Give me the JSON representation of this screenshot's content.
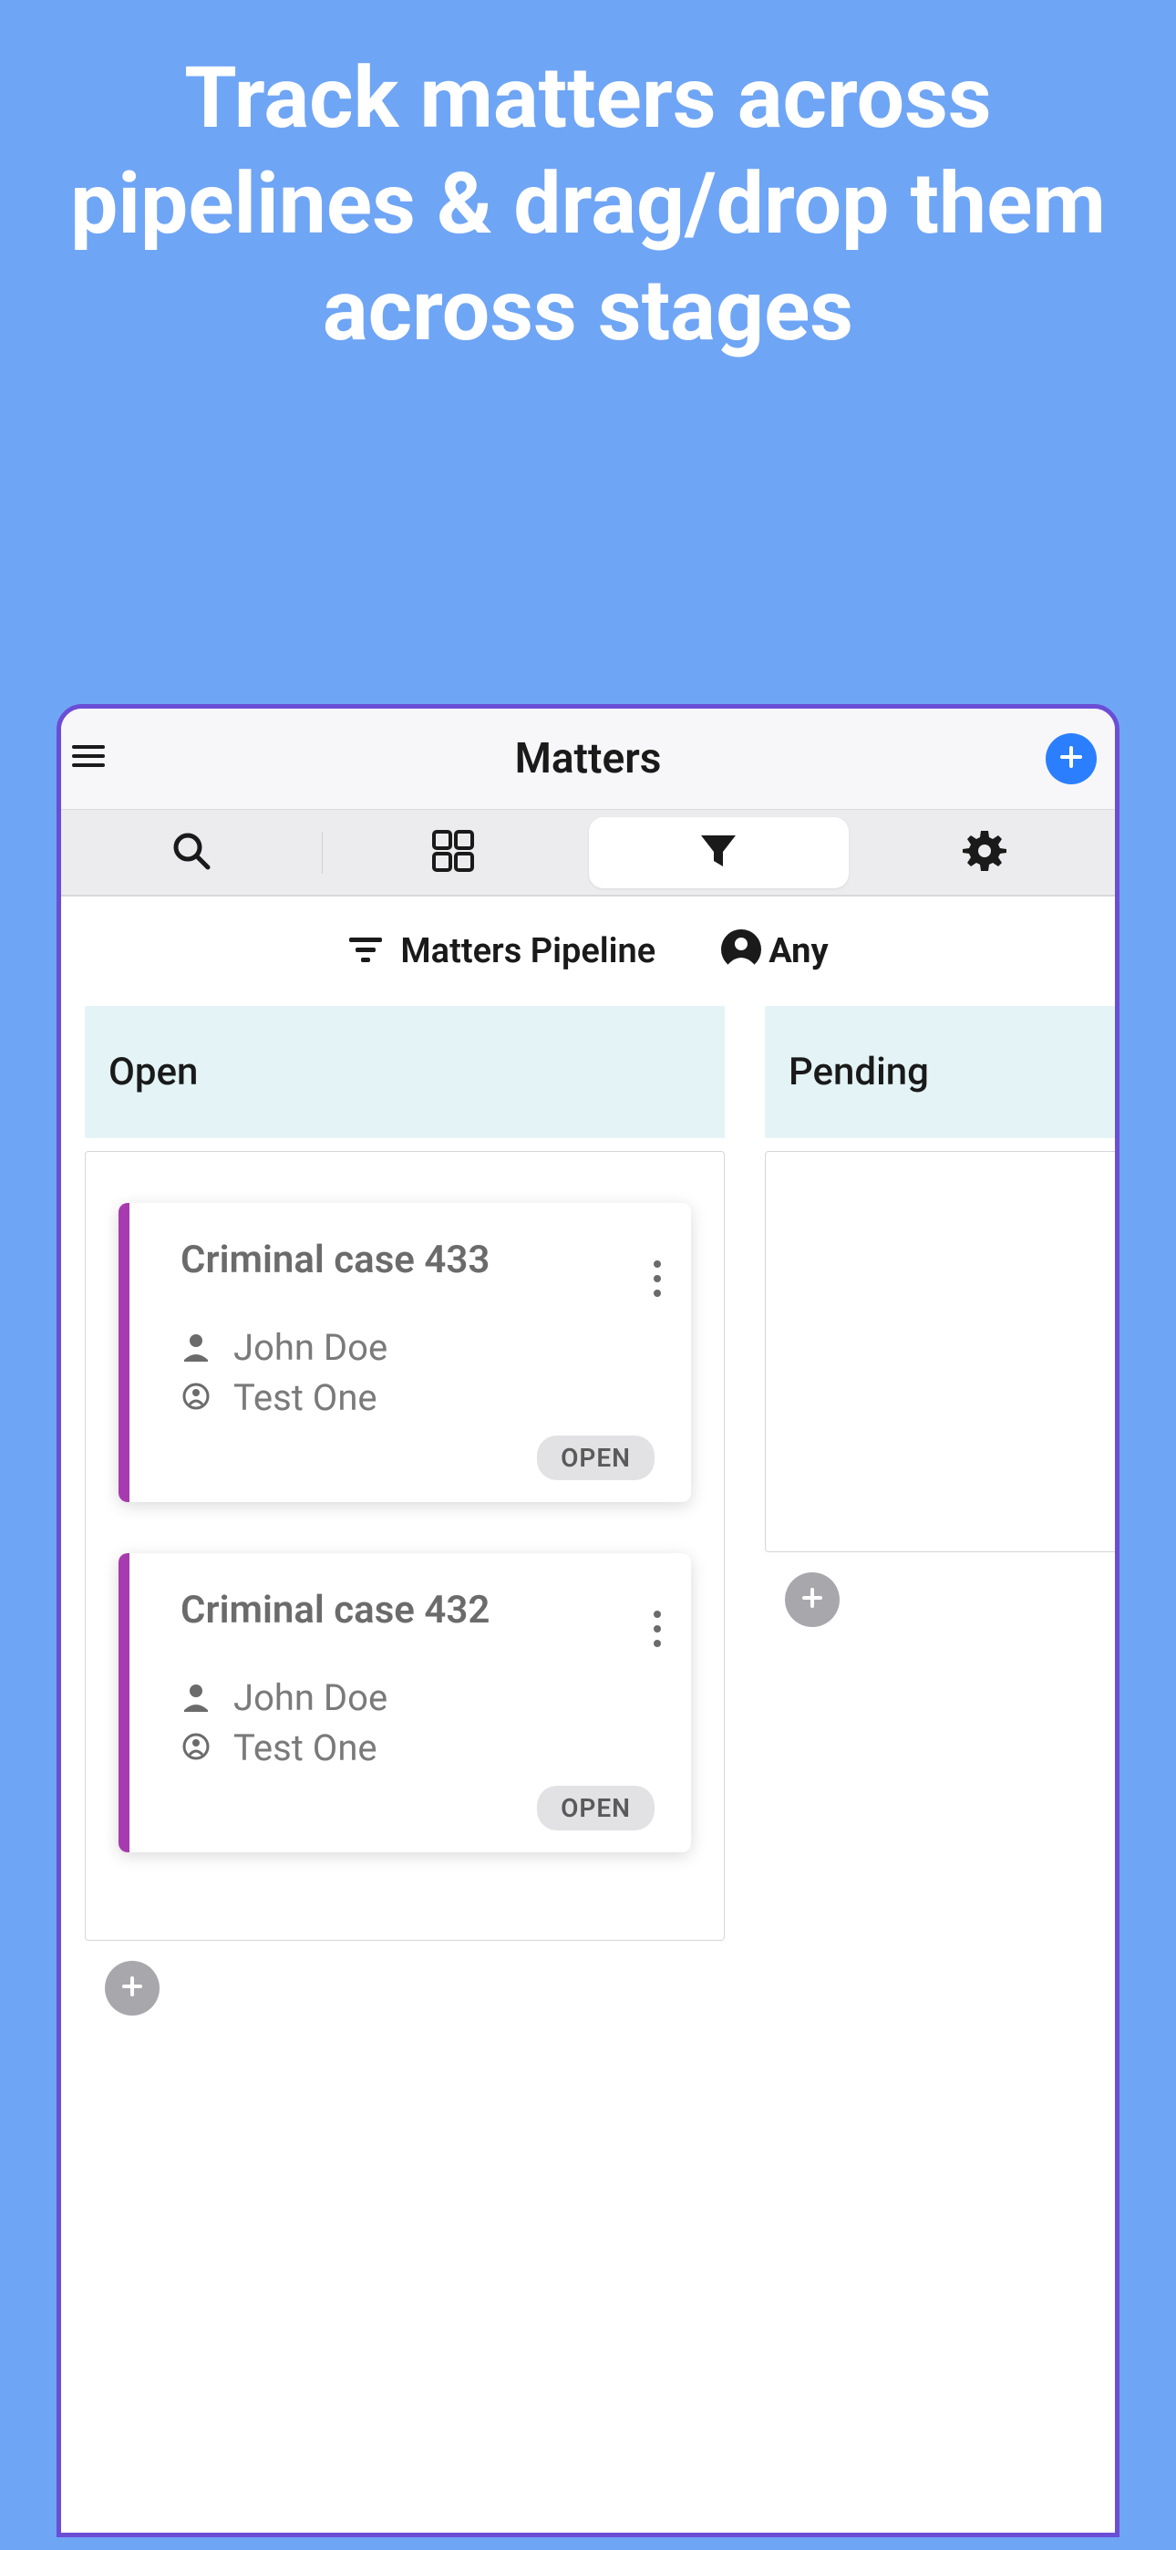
{
  "promo": {
    "heading": "Track matters across pipelines & drag/drop them across stages"
  },
  "header": {
    "title": "Matters"
  },
  "filter": {
    "pipeline_label": "Matters Pipeline",
    "assignee_label": "Any"
  },
  "columns": [
    {
      "title": "Open",
      "cards": [
        {
          "title": "Criminal case 433",
          "person": "John Doe",
          "client": "Test One",
          "status": "OPEN"
        },
        {
          "title": "Criminal case 432",
          "person": "John Doe",
          "client": "Test One",
          "status": "OPEN"
        }
      ]
    },
    {
      "title": "Pending",
      "cards": []
    }
  ]
}
